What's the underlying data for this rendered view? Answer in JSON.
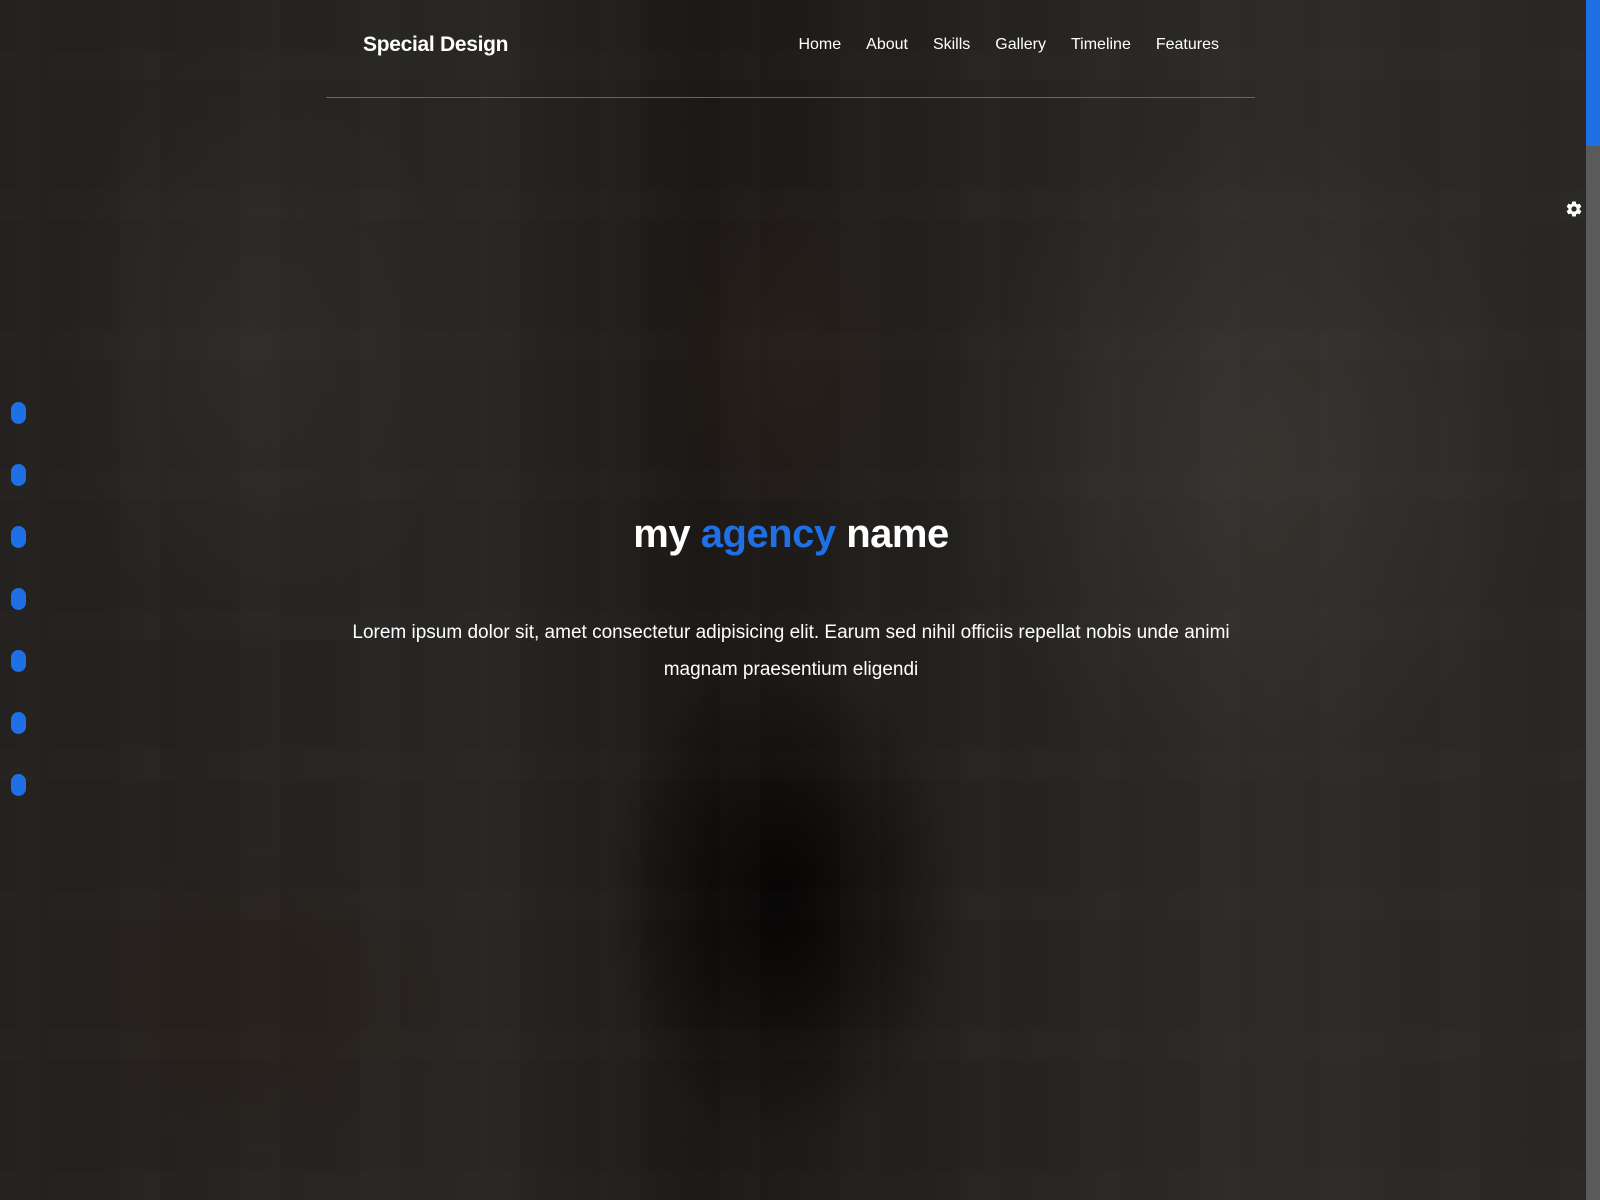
{
  "header": {
    "logo": "Special Design",
    "nav": [
      "Home",
      "About",
      "Skills",
      "Gallery",
      "Timeline",
      "Features"
    ]
  },
  "hero": {
    "title_part1": "my",
    "title_accent": "agency",
    "title_part2": "name",
    "text": "Lorem ipsum dolor sit, amet consectetur adipisicing elit. Earum sed nihil officiis repellat nobis unde animi magnam praesentium eligendi"
  },
  "bullets_count": 7,
  "settings": {
    "icon": "gear-icon"
  },
  "colors": {
    "accent": "#1f6fe5",
    "text": "#ffffff",
    "overlay": "rgba(0,0,0,0.62)",
    "scrollbar_track": "#5a5a5a"
  }
}
